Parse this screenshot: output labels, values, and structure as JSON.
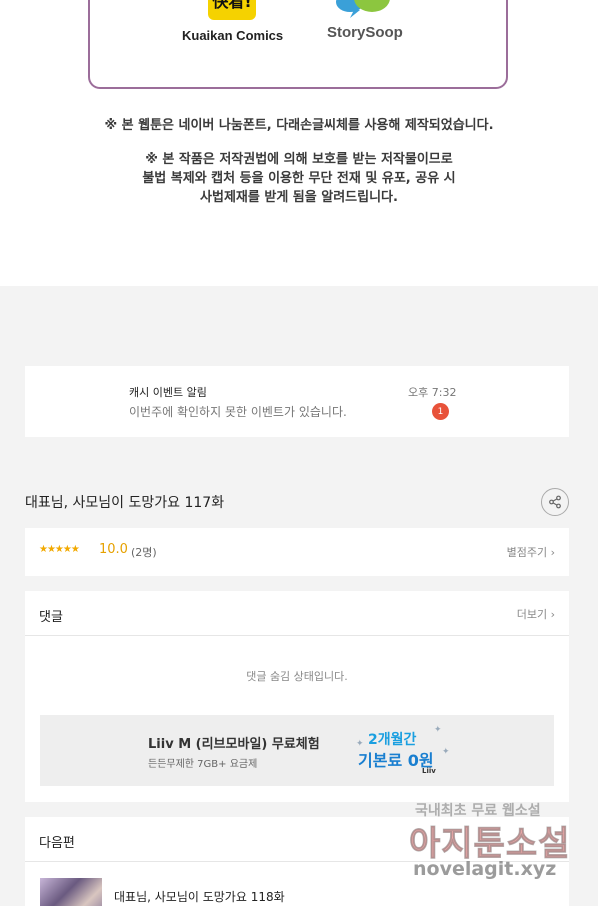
{
  "credits": {
    "kuaikan_logo_text": "快看!",
    "kuaikan_label": "Kuaikan Comics",
    "storysoop_label": "StorySoop"
  },
  "notices": {
    "font_notice": "※ 본 웹툰은 네이버 나눔폰트, 다래손글씨체를 사용해 제작되었습니다.",
    "copyright_line1": "※ 본 작품은 저작권법에 의해 보호를 받는 저작물이므로",
    "copyright_line2": "불법 복제와 캡처 등을 이용한 무단 전재 및 유포, 공유 시",
    "copyright_line3": "사법제재를 받게 됨을 알려드립니다."
  },
  "event": {
    "title": "캐시 이벤트 알림",
    "subtitle": "이번주에 확인하지 못한 이벤트가 있습니다.",
    "time": "오후 7:32",
    "badge": "1"
  },
  "episode": {
    "title": "대표님, 사모님이 도망가요 117화"
  },
  "rating": {
    "stars": "★★★★★",
    "score": "10.0",
    "count": "(2명)",
    "rate_link": "별점주기"
  },
  "comments": {
    "title": "댓글",
    "more": "더보기",
    "hidden_msg": "댓글 숨김 상태입니다."
  },
  "ad": {
    "title": "Liiv M (리브모바일) 무료체험",
    "subtitle": "든든무제한 7GB+ 요금제",
    "promo_line1": "2개월간",
    "promo_line2": "기본료 0원",
    "promo_brand": "Liiv"
  },
  "next": {
    "title": "다음편",
    "episode_title": "대표님, 사모님이 도망가요 118화"
  },
  "watermark": {
    "line1": "국내최초 무료 웹소설",
    "line2": "아지툰소설",
    "line3": "novelagit.xyz"
  },
  "colors": {
    "accent_star": "#f2a900",
    "badge": "#e8523a",
    "frame": "#9b6d9a"
  }
}
